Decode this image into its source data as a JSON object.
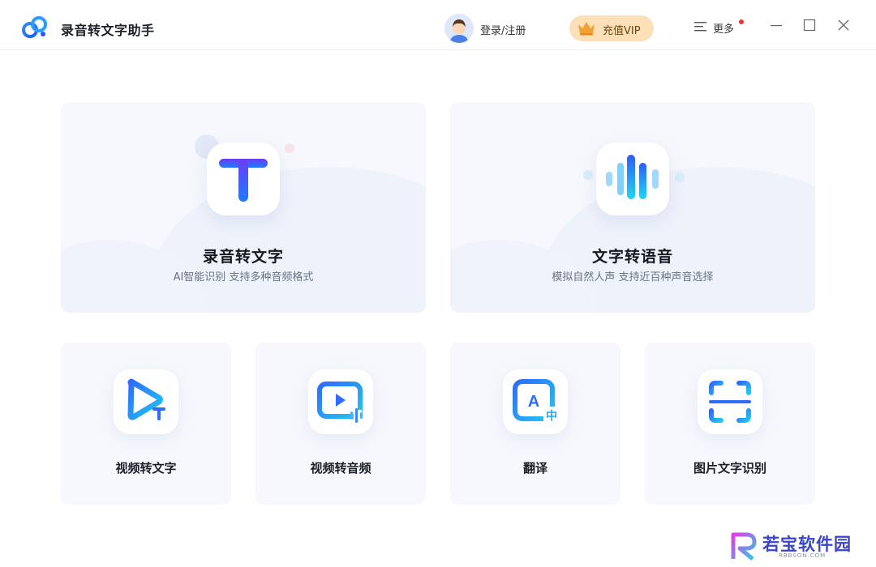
{
  "app": {
    "title": "录音转文字助手"
  },
  "header": {
    "login_label": "登录/注册",
    "vip_label": "充值VIP",
    "more_label": "更多",
    "icons": {
      "logo": "cloud-logo-icon",
      "avatar": "user-avatar",
      "crown": "crown-icon",
      "menu": "menu-icon",
      "minimize": "minimize-icon",
      "maximize": "maximize-icon",
      "close": "close-icon"
    }
  },
  "features": {
    "primary": [
      {
        "title": "录音转文字",
        "subtitle": "AI智能识别 支持多种音频格式",
        "icon": "text-t-icon"
      },
      {
        "title": "文字转语音",
        "subtitle": "模拟自然人声 支持近百种声音选择",
        "icon": "sound-wave-icon"
      }
    ],
    "secondary": [
      {
        "title": "视频转文字",
        "icon": "video-to-text-icon"
      },
      {
        "title": "视频转音频",
        "icon": "video-to-audio-icon"
      },
      {
        "title": "翻译",
        "icon": "translate-icon"
      },
      {
        "title": "图片文字识别",
        "icon": "scan-ocr-icon"
      }
    ]
  },
  "watermark": {
    "text": "若宝软件园",
    "sub": "RBBSON.COM"
  },
  "colors": {
    "accent_blue": "#2f6bff",
    "accent_cyan": "#1fd0f0",
    "vip_bg": "#fde0b7",
    "card_bg": "#f6f8fd"
  }
}
